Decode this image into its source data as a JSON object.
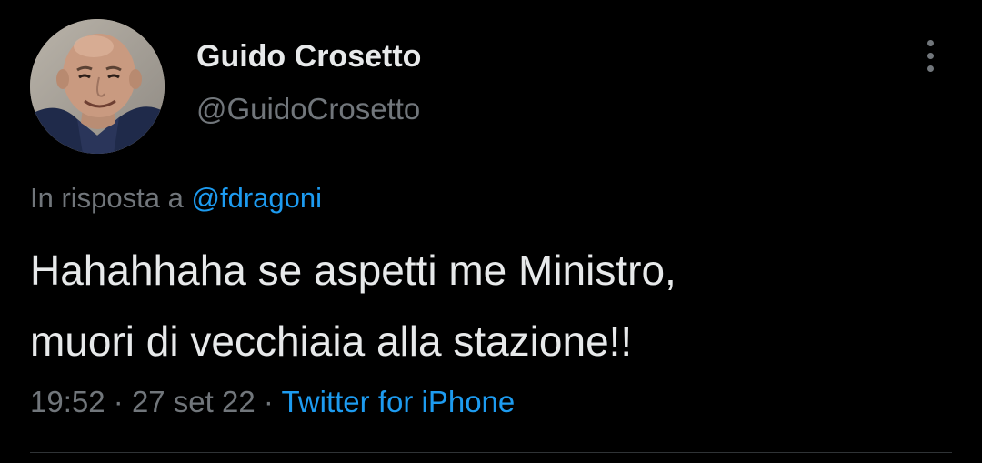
{
  "author": {
    "display_name": "Guido Crosetto",
    "handle": "@GuidoCrosetto"
  },
  "reply": {
    "prefix": "In risposta a",
    "mention": "@fdragoni"
  },
  "tweet": {
    "line1": "Hahahhaha se aspetti me Ministro,",
    "line2": "muori di vecchiaia alla stazione!!"
  },
  "meta": {
    "time": "19:52",
    "separator": "·",
    "date": "27 set 22",
    "source": "Twitter for iPhone"
  },
  "icons": {
    "more": "more-vertical-icon"
  },
  "colors": {
    "background": "#000000",
    "primary_text": "#e7e9ea",
    "secondary_text": "#71767b",
    "accent": "#1d9bf0",
    "divider": "#2f3336"
  }
}
